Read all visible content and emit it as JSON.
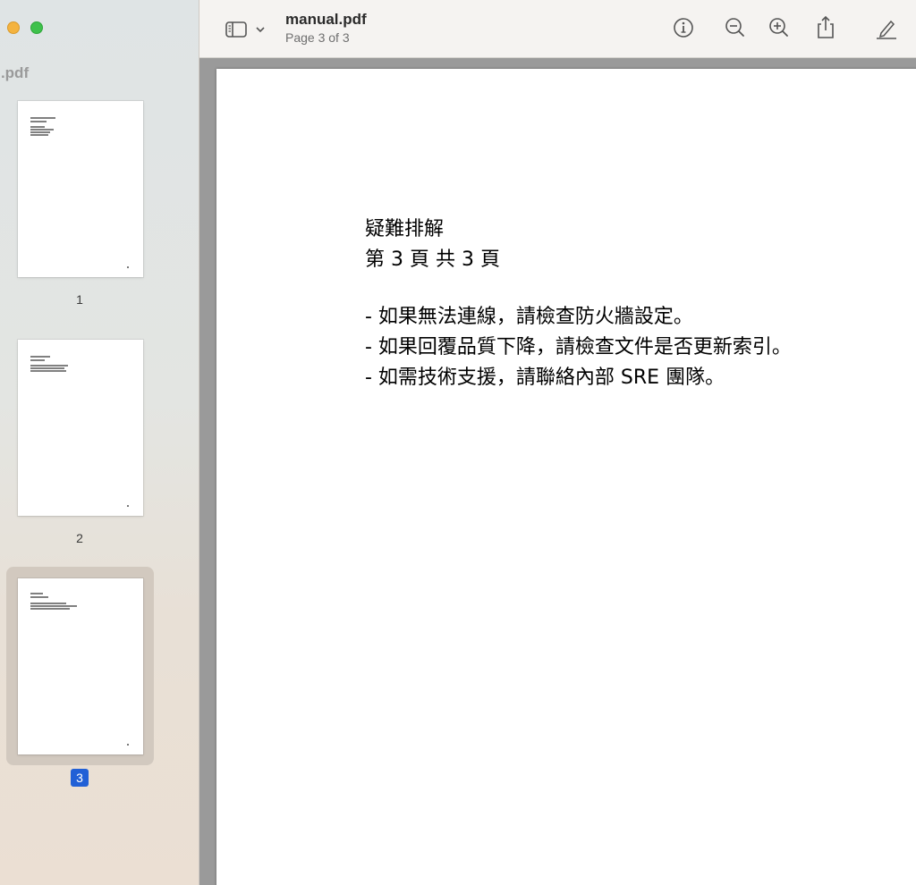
{
  "window": {
    "sidebar_title": "nual.pdf"
  },
  "toolbar": {
    "title": "manual.pdf",
    "subtitle": "Page 3 of 3",
    "icons": {
      "sidebar_toggle": "sidebar-icon",
      "info": "info-icon",
      "zoom_out": "zoom-out-icon",
      "zoom_in": "zoom-in-icon",
      "share": "share-icon",
      "markup": "markup-pen-icon"
    }
  },
  "thumbnails": [
    {
      "label": "1",
      "selected": false
    },
    {
      "label": "2",
      "selected": false
    },
    {
      "label": "3",
      "selected": true
    }
  ],
  "document": {
    "page_heading": "疑難排解",
    "page_counter": "第 3 頁 共 3 頁",
    "lines": [
      "- 如果無法連線，請檢查防火牆設定。",
      "- 如果回覆品質下降，請檢查文件是否更新索引。",
      "- 如需技術支援，請聯絡內部 SRE 團隊。"
    ]
  },
  "colors": {
    "selection_accent": "#2160d6",
    "traffic_minimize": "#f4b33f",
    "traffic_maximize": "#3ec14b"
  }
}
